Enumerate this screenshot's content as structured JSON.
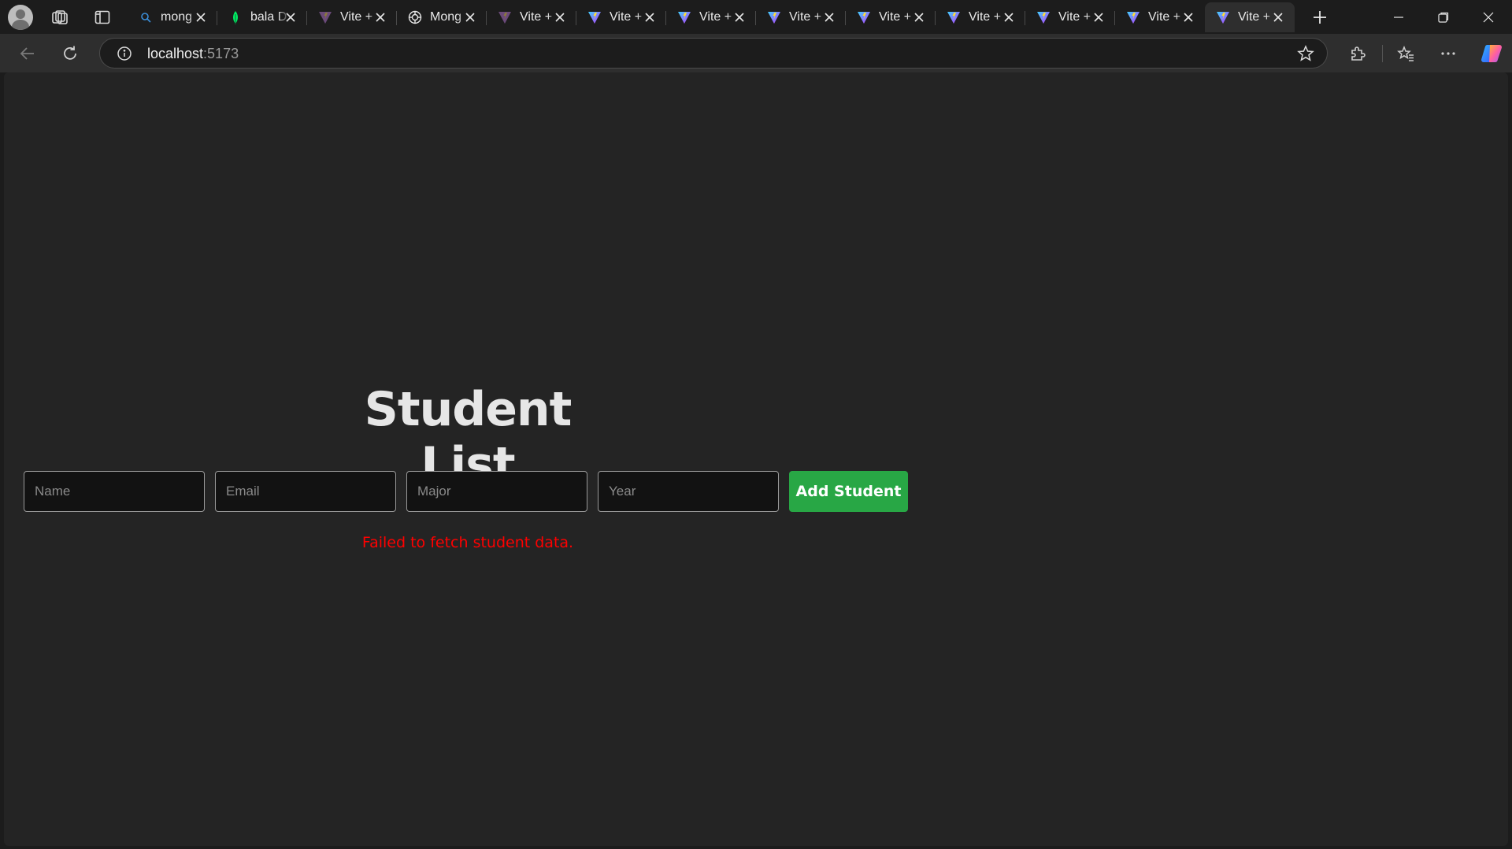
{
  "browser": {
    "tabs": [
      {
        "title": "mong",
        "favicon": "search-favicon",
        "active": false
      },
      {
        "title": "bala D",
        "favicon": "mongodb-leaf-favicon",
        "active": false
      },
      {
        "title": "Vite +",
        "favicon": "vite-favicon",
        "active": false
      },
      {
        "title": "Mong",
        "favicon": "openai-favicon",
        "active": false
      },
      {
        "title": "Vite +",
        "favicon": "vite-favicon",
        "active": false
      },
      {
        "title": "Vite +",
        "favicon": "vite-favicon",
        "active": false
      },
      {
        "title": "Vite +",
        "favicon": "vite-favicon",
        "active": false
      },
      {
        "title": "Vite +",
        "favicon": "vite-favicon",
        "active": false
      },
      {
        "title": "Vite +",
        "favicon": "vite-favicon",
        "active": false
      },
      {
        "title": "Vite +",
        "favicon": "vite-favicon",
        "active": false
      },
      {
        "title": "Vite +",
        "favicon": "vite-favicon",
        "active": false
      },
      {
        "title": "Vite +",
        "favicon": "vite-favicon",
        "active": false
      },
      {
        "title": "Vite +",
        "favicon": "vite-favicon",
        "active": true
      }
    ],
    "address": {
      "host": "localhost",
      "port": ":5173"
    }
  },
  "page": {
    "title": "Student List",
    "form": {
      "name_placeholder": "Name",
      "email_placeholder": "Email",
      "major_placeholder": "Major",
      "year_placeholder": "Year",
      "submit_label": "Add Student"
    },
    "error_message": "Failed to fetch student data."
  },
  "colors": {
    "page_background": "#242424",
    "title_text": "#e6e6e6",
    "button_green": "#28a745",
    "error_red": "#ff0000"
  }
}
